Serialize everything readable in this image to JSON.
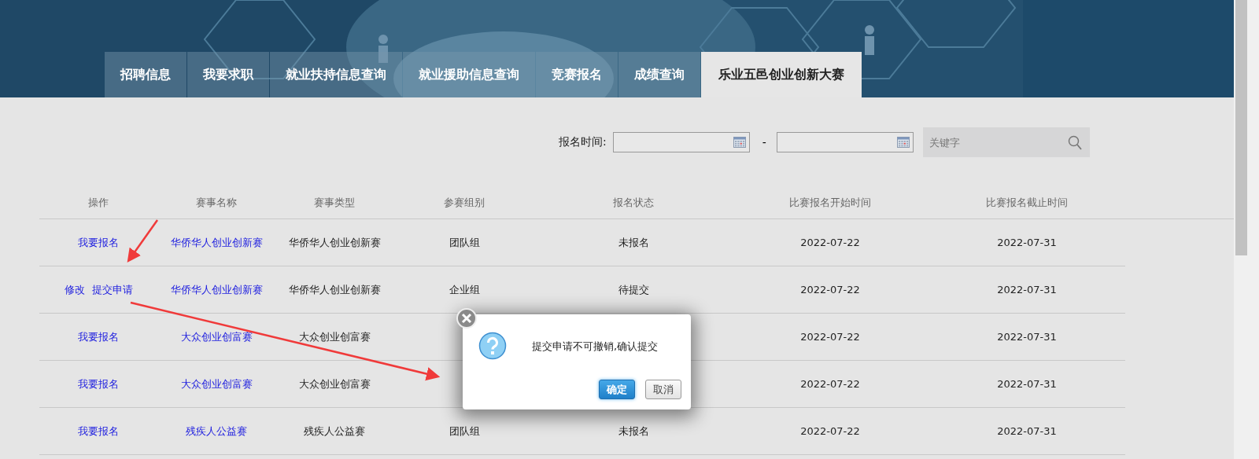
{
  "tabs": [
    {
      "label": "招聘信息",
      "selected": false
    },
    {
      "label": "我要求职",
      "selected": false
    },
    {
      "label": "就业扶持信息查询",
      "selected": false
    },
    {
      "label": "就业援助信息查询",
      "selected": false
    },
    {
      "label": "竞赛报名",
      "selected": false
    },
    {
      "label": "成绩查询",
      "selected": false
    },
    {
      "label": "乐业五邑创业创新大赛",
      "selected": true
    }
  ],
  "filter": {
    "label": "报名时间:",
    "separator": "-",
    "search_placeholder": "关键字"
  },
  "table": {
    "columns": [
      "操作",
      "赛事名称",
      "赛事类型",
      "参赛组别",
      "报名状态",
      "比赛报名开始时间",
      "比赛报名截止时间"
    ],
    "rows": [
      {
        "actions": [
          "我要报名"
        ],
        "name": "华侨华人创业创新赛",
        "type": "华侨华人创业创新赛",
        "group": "团队组",
        "status": "未报名",
        "start": "2022-07-22",
        "end": "2022-07-31"
      },
      {
        "actions": [
          "修改",
          "提交申请"
        ],
        "name": "华侨华人创业创新赛",
        "type": "华侨华人创业创新赛",
        "group": "企业组",
        "status": "待提交",
        "start": "2022-07-22",
        "end": "2022-07-31"
      },
      {
        "actions": [
          "我要报名"
        ],
        "name": "大众创业创富赛",
        "type": "大众创业创富赛",
        "start": "2022-07-22",
        "end": "2022-07-31"
      },
      {
        "actions": [
          "我要报名"
        ],
        "name": "大众创业创富赛",
        "type": "大众创业创富赛",
        "start": "2022-07-22",
        "end": "2022-07-31"
      },
      {
        "actions": [
          "我要报名"
        ],
        "name": "残疾人公益赛",
        "type": "残疾人公益赛",
        "group": "团队组",
        "status": "未报名",
        "start": "2022-07-22",
        "end": "2022-07-31"
      }
    ]
  },
  "dialog": {
    "message": "提交申请不可撤销,确认提交",
    "buttons": [
      {
        "label": "确定",
        "kind": "primary"
      },
      {
        "label": "取消",
        "kind": "secondary"
      }
    ]
  }
}
